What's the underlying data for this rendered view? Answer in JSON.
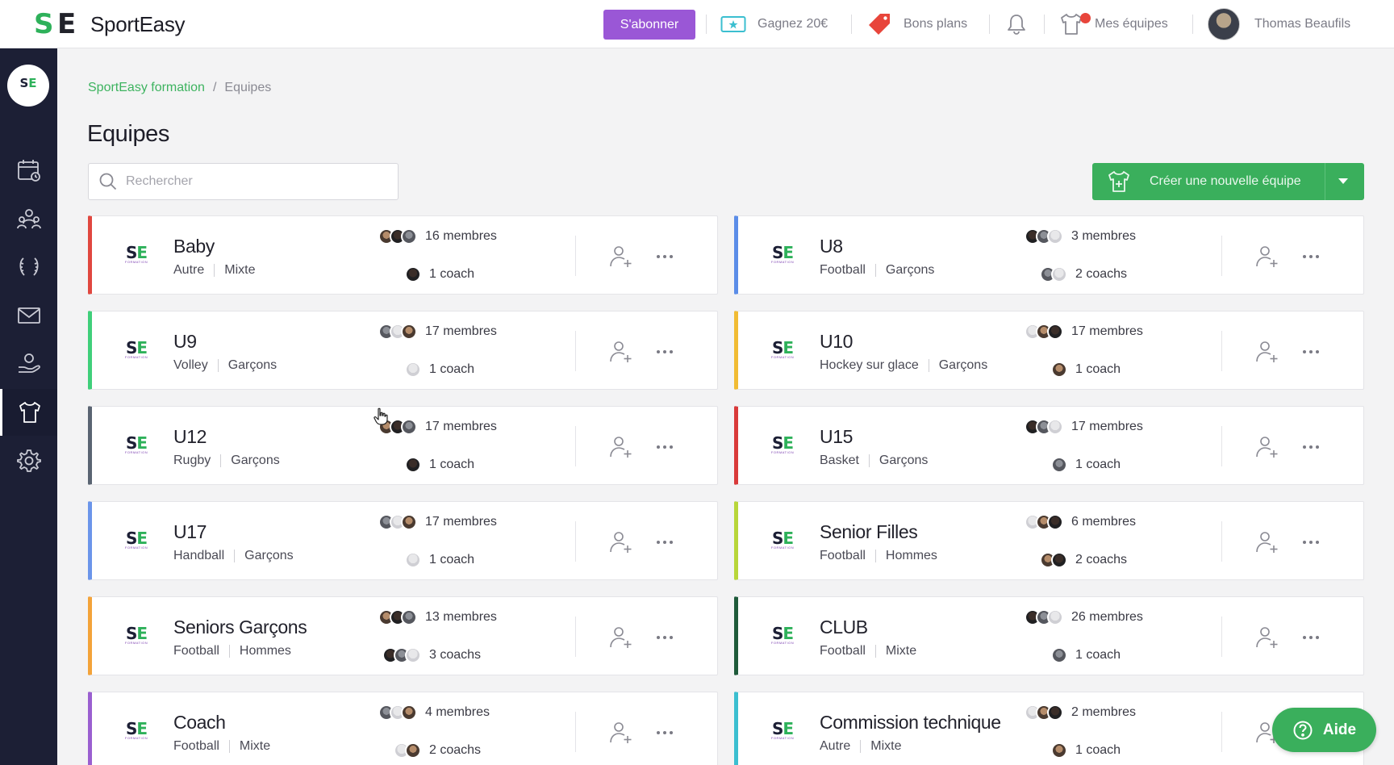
{
  "header": {
    "brand_name": "SportEasy",
    "subscribe_label": "S'abonner",
    "referral_label": "Gagnez 20€",
    "deals_label": "Bons plans",
    "my_teams_label": "Mes équipes",
    "user_name": "Thomas Beaufils"
  },
  "breadcrumb": {
    "root": "SportEasy formation",
    "separator": "/",
    "current": "Equipes"
  },
  "page": {
    "title": "Equipes",
    "search_placeholder": "Rechercher",
    "create_team_label": "Créer une nouvelle équipe"
  },
  "teams": [
    {
      "name": "Baby",
      "sport": "Autre",
      "category": "Mixte",
      "members": "16 membres",
      "coaches": "1 coach",
      "color": "#e0473f",
      "member_avatars": 3,
      "coach_avatars": 1
    },
    {
      "name": "U8",
      "sport": "Football",
      "category": "Garçons",
      "members": "3 membres",
      "coaches": "2 coachs",
      "color": "#5b8de8",
      "member_avatars": 3,
      "coach_avatars": 2
    },
    {
      "name": "U9",
      "sport": "Volley",
      "category": "Garçons",
      "members": "17 membres",
      "coaches": "1 coach",
      "color": "#3fcf7a",
      "member_avatars": 3,
      "coach_avatars": 1
    },
    {
      "name": "U10",
      "sport": "Hockey sur glace",
      "category": "Garçons",
      "members": "17 membres",
      "coaches": "1 coach",
      "color": "#f1bc34",
      "member_avatars": 3,
      "coach_avatars": 1
    },
    {
      "name": "U12",
      "sport": "Rugby",
      "category": "Garçons",
      "members": "17 membres",
      "coaches": "1 coach",
      "color": "#5a6472",
      "member_avatars": 3,
      "coach_avatars": 1
    },
    {
      "name": "U15",
      "sport": "Basket",
      "category": "Garçons",
      "members": "17 membres",
      "coaches": "1 coach",
      "color": "#d93a3a",
      "member_avatars": 3,
      "coach_avatars": 1
    },
    {
      "name": "U17",
      "sport": "Handball",
      "category": "Garçons",
      "members": "17 membres",
      "coaches": "1 coach",
      "color": "#6b95ea",
      "member_avatars": 3,
      "coach_avatars": 1
    },
    {
      "name": "Senior Filles",
      "sport": "Football",
      "category": "Hommes",
      "members": "6 membres",
      "coaches": "2 coachs",
      "color": "#b8d63a",
      "member_avatars": 3,
      "coach_avatars": 2
    },
    {
      "name": "Seniors Garçons",
      "sport": "Football",
      "category": "Hommes",
      "members": "13 membres",
      "coaches": "3 coachs",
      "color": "#f3a33a",
      "member_avatars": 3,
      "coach_avatars": 3
    },
    {
      "name": "CLUB",
      "sport": "Football",
      "category": "Mixte",
      "members": "26 membres",
      "coaches": "1 coach",
      "color": "#1e5a3a",
      "member_avatars": 3,
      "coach_avatars": 1
    },
    {
      "name": "Coach",
      "sport": "Football",
      "category": "Mixte",
      "members": "4 membres",
      "coaches": "2 coachs",
      "color": "#9a5fd0",
      "member_avatars": 3,
      "coach_avatars": 2
    },
    {
      "name": "Commission technique",
      "sport": "Autre",
      "category": "Mixte",
      "members": "2 membres",
      "coaches": "1 coach",
      "color": "#3bbfd0",
      "member_avatars": 3,
      "coach_avatars": 1
    }
  ],
  "help": {
    "label": "Aide"
  },
  "sidebar": {
    "items": [
      "calendar-icon",
      "members-icon",
      "trophy-icon",
      "mail-icon",
      "payments-icon",
      "teams-icon",
      "settings-icon"
    ],
    "active": "teams-icon"
  },
  "colors": {
    "brand_green": "#3aaf5c",
    "subscribe_purple": "#9a57d6",
    "sidebar_bg": "#1c1f35"
  }
}
